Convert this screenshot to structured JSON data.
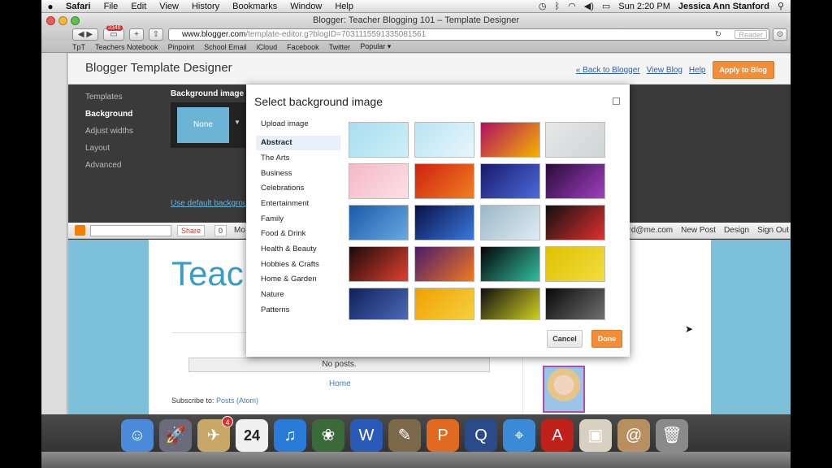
{
  "menubar": {
    "app": "Safari",
    "items": [
      "File",
      "Edit",
      "View",
      "History",
      "Bookmarks",
      "Window",
      "Help"
    ],
    "clock": "Sun 2:20 PM",
    "user": "Jessica Ann Stanford"
  },
  "window": {
    "title": "Blogger: Teacher Blogging 101 – Template Designer",
    "badge": "3346",
    "url_host": "www.blogger.com",
    "url_path": "/template-editor.g?blogID=7031115591335081561",
    "reader": "Reader"
  },
  "bookmarks": [
    "TpT",
    "Teachers Notebook",
    "Pinpoint",
    "School Email",
    "iCloud",
    "Facebook",
    "Twitter",
    "Popular ▾"
  ],
  "designer": {
    "title": "Blogger Template Designer",
    "links": [
      "« Back to Blogger",
      "View Blog",
      "Help"
    ],
    "apply": "Apply to Blog",
    "sidebar": [
      "Templates",
      "Background",
      "Adjust widths",
      "Layout",
      "Advanced"
    ],
    "bg_label": "Background image",
    "none": "None",
    "use_default": "Use default background"
  },
  "blog_bar": {
    "share": "Share",
    "share_count": "0",
    "more": "Mo",
    "email": "ford@me.com",
    "new_post": "New Post",
    "design": "Design",
    "sign_out": "Sign Out"
  },
  "blog": {
    "title": "Teac",
    "no_posts": "No posts.",
    "home": "Home",
    "subscribe_label": "Subscribe to:",
    "subscribe_link": "Posts (Atom)"
  },
  "modal": {
    "title": "Select background image",
    "upload": "Upload image",
    "categories": [
      "Abstract",
      "The Arts",
      "Business",
      "Celebrations",
      "Entertainment",
      "Family",
      "Food & Drink",
      "Health & Beauty",
      "Hobbies & Crafts",
      "Home & Garden",
      "Nature",
      "Patterns"
    ],
    "selected": "Abstract",
    "cancel": "Cancel",
    "done": "Done",
    "thumbs": [
      [
        "#a8def0",
        "#cfeef8"
      ],
      [
        "#b8e4f2",
        "#e8f7fc"
      ],
      [
        "#b01060",
        "#f6b200"
      ],
      [
        "#e8e8e8",
        "#cfd4d6"
      ],
      [
        "#f5b8c6",
        "#fbe0e6"
      ],
      [
        "#d02010",
        "#f08020"
      ],
      [
        "#1a1a6a",
        "#4a6adc"
      ],
      [
        "#2a0a3a",
        "#a040c0"
      ],
      [
        "#1a5aa8",
        "#6aa8e0"
      ],
      [
        "#08104a",
        "#3a7adc"
      ],
      [
        "#9ab8c8",
        "#e0ecf2"
      ],
      [
        "#101010",
        "#e03030"
      ],
      [
        "#1a0a0a",
        "#e04030"
      ],
      [
        "#4a1a6a",
        "#f07a20"
      ],
      [
        "#050505",
        "#30c0a0"
      ],
      [
        "#e0c000",
        "#f2de40"
      ],
      [
        "#10205a",
        "#4a6ab8"
      ],
      [
        "#f0a000",
        "#f6d040"
      ],
      [
        "#101010",
        "#d0d020"
      ],
      [
        "#080808",
        "#707070"
      ]
    ]
  },
  "dock": [
    "finder-icon",
    "launchpad-icon",
    "mail-icon",
    "calendar-icon",
    "itunes-icon",
    "iphoto-icon",
    "word-icon",
    "gimp-icon",
    "powerpoint-icon",
    "quicktime-icon",
    "safari-icon",
    "acrobat-icon",
    "preview-icon",
    "addressbook-icon",
    "trash-icon"
  ],
  "dock_badge": "4",
  "calendar_day": "24",
  "colors": {
    "accent": "#f28d38",
    "blogger_blue": "#6bb4d6",
    "dark_panel": "#3a3a3a"
  }
}
